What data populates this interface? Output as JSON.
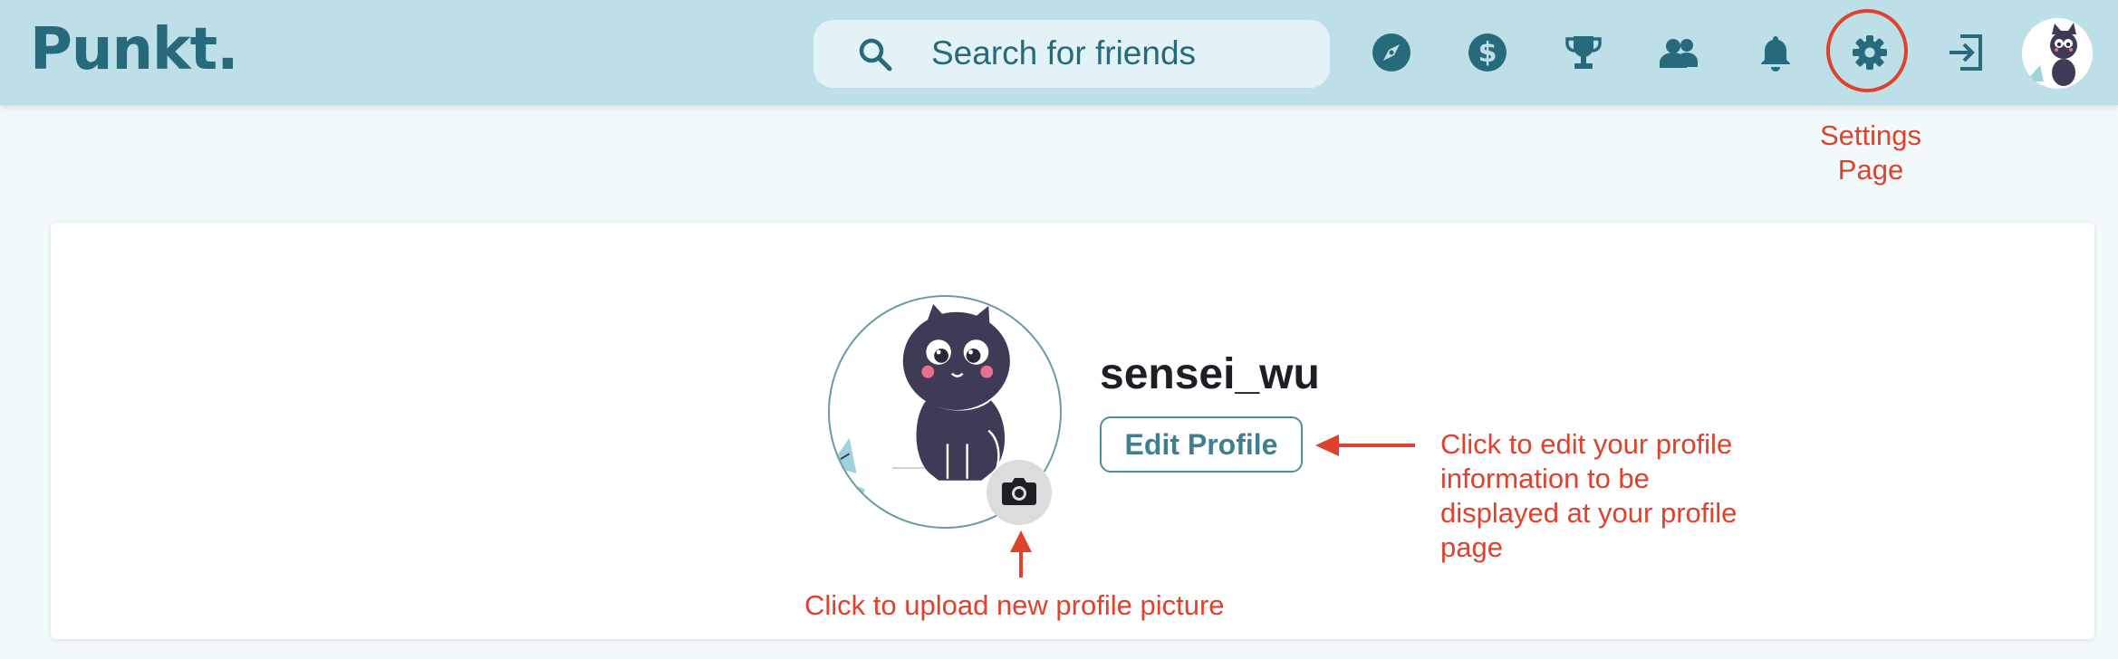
{
  "header": {
    "logo": "Punkt.",
    "search": {
      "placeholder": "Search for friends",
      "value": ""
    },
    "nav_icons": [
      "compass-icon",
      "dollar-icon",
      "trophy-icon",
      "friends-icon",
      "bell-icon",
      "gear-icon",
      "logout-icon",
      "avatar"
    ]
  },
  "annotations": {
    "settings": "Settings Page",
    "edit_profile": "Click to edit your profile information to be displayed at your profile page",
    "upload_picture": "Click to upload new profile picture"
  },
  "profile": {
    "username": "sensei_wu",
    "edit_label": "Edit Profile"
  },
  "colors": {
    "header_bg": "#bddfe7",
    "brand": "#276a7b",
    "annotation": "#e0412c",
    "page_bg": "#f1f9fb"
  }
}
